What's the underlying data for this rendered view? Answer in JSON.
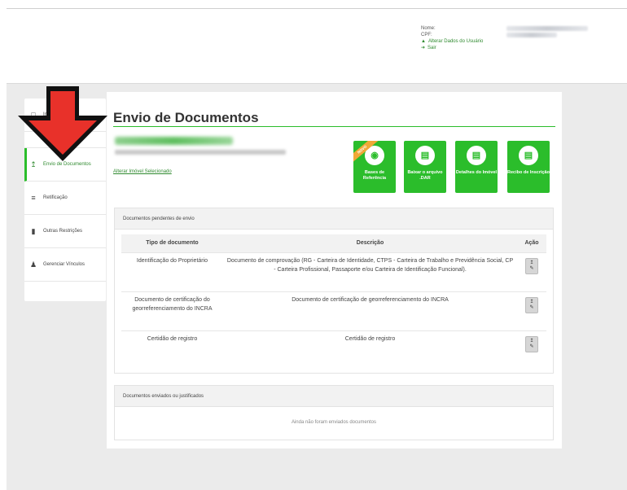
{
  "user": {
    "name_label": "Nome:",
    "cpf_label": "CPF:",
    "update_link": "Alterar Dados do Usuário",
    "logout_link": "Sair"
  },
  "sidebar": {
    "items": [
      {
        "label": "Im... do",
        "icon": "building-icon"
      },
      {
        "label": "Envio de Documentos",
        "icon": "upload-icon"
      },
      {
        "label": "Retificação",
        "icon": "edit-lines-icon"
      },
      {
        "label": "Outras Restrições",
        "icon": "document-icon"
      },
      {
        "label": "Gerenciar Vínculos",
        "icon": "user-icon"
      }
    ]
  },
  "main": {
    "title": "Envio de Documentos",
    "change_property_link": "Alterar Imóvel Selecionado",
    "buttons": [
      {
        "label": "Bases de Referência",
        "ribbon": "NOVO"
      },
      {
        "label": "Baixar o arquivo .DAR"
      },
      {
        "label": "Detalhes do Imóvel"
      },
      {
        "label": "Recibo de Inscrição"
      }
    ],
    "pending_panel": {
      "title": "Documentos pendentes de envio",
      "columns": [
        "Tipo de documento",
        "Descrição",
        "Ação"
      ],
      "rows": [
        {
          "type": "Identificação do Proprietário",
          "description": "Documento de comprovação (RG - Carteira de Identidade, CTPS - Carteira de Trabalho e Previdência Social, CP - Carteira Profissional, Passaporte e/ou Carteira de Identificação Funcional)."
        },
        {
          "type": "Documento de certificação do georreferenciamento do INCRA",
          "description": "Documento de certificação de georreferenciamento do INCRA"
        },
        {
          "type": "Certidão de registro",
          "description": "Certidão de registro"
        }
      ]
    },
    "sent_panel": {
      "title": "Documentos enviados ou justificados",
      "empty_message": "Ainda não foram enviados documentos"
    }
  },
  "colors": {
    "accent": "#2bbd2b",
    "link": "#2f8a2f",
    "arrow_red": "#e8312a",
    "ribbon": "#f0a838"
  }
}
